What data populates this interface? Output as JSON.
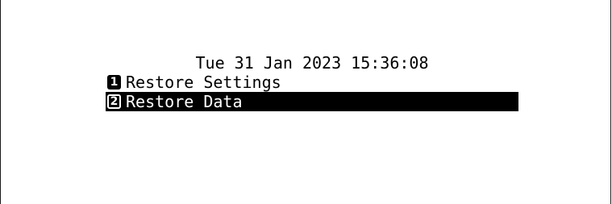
{
  "display": {
    "datetime": "Tue 31 Jan 2023 15:36:08"
  },
  "menu": {
    "items": [
      {
        "number": "1",
        "label": "Restore Settings",
        "selected": false
      },
      {
        "number": "2",
        "label": "Restore Data",
        "selected": true
      }
    ]
  },
  "colors": {
    "background": "#ffffff",
    "text": "#000000",
    "highlight_bg": "#000000",
    "highlight_text": "#ffffff"
  }
}
